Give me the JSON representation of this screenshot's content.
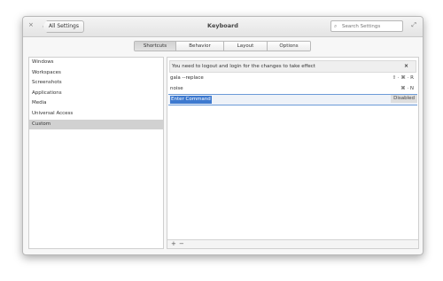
{
  "window": {
    "title": "Keyboard",
    "back_label": "All Settings",
    "search_placeholder": "Search Settings",
    "close_icon": "×",
    "maximize_icon": "⤢",
    "search_icon": "⌕"
  },
  "tabs": [
    {
      "label": "Shortcuts",
      "active": true
    },
    {
      "label": "Behavior"
    },
    {
      "label": "Layout"
    },
    {
      "label": "Options"
    }
  ],
  "categories": [
    "Windows",
    "Workspaces",
    "Screenshots",
    "Applications",
    "Media",
    "Universal Access",
    "Custom"
  ],
  "selected_category": "Custom",
  "infobar": {
    "message": "You need to logout and login for the changes to take effect",
    "close": "×"
  },
  "shortcuts": [
    {
      "command": "gala --replace",
      "shortcut": "⇧ · ⌘ · R"
    },
    {
      "command": "noise",
      "shortcut": "⌘ · N"
    },
    {
      "command": "Enter Command",
      "shortcut": "Disabled"
    }
  ],
  "toolbar": {
    "add": "+",
    "remove": "−"
  }
}
